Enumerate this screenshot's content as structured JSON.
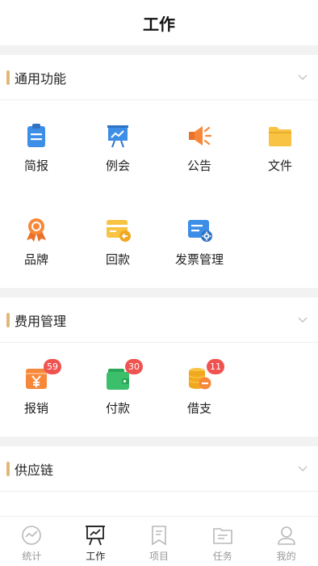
{
  "header": {
    "title": "工作"
  },
  "sections": [
    {
      "title": "通用功能",
      "items": [
        {
          "label": "简报",
          "icon": "clipboard-icon"
        },
        {
          "label": "例会",
          "icon": "presentation-board-icon"
        },
        {
          "label": "公告",
          "icon": "megaphone-icon"
        },
        {
          "label": "文件",
          "icon": "folder-icon"
        },
        {
          "label": "品牌",
          "icon": "award-ribbon-icon"
        },
        {
          "label": "回款",
          "icon": "card-return-icon"
        },
        {
          "label": "发票管理",
          "icon": "invoice-settings-icon"
        }
      ]
    },
    {
      "title": "费用管理",
      "items": [
        {
          "label": "报销",
          "icon": "yuan-tray-icon",
          "badge": "59"
        },
        {
          "label": "付款",
          "icon": "wallet-icon",
          "badge": "30"
        },
        {
          "label": "借支",
          "icon": "coin-stack-icon",
          "badge": "11"
        }
      ]
    },
    {
      "title": "供应链",
      "items": []
    }
  ],
  "tabbar": [
    {
      "label": "统计",
      "icon": "pulse-circle-icon",
      "active": false
    },
    {
      "label": "工作",
      "icon": "presentation-board-icon",
      "active": true
    },
    {
      "label": "项目",
      "icon": "bookmark-list-icon",
      "active": false
    },
    {
      "label": "任务",
      "icon": "task-folder-icon",
      "active": false
    },
    {
      "label": "我的",
      "icon": "user-icon",
      "active": false
    }
  ],
  "colors": {
    "section_accent": "#e3b777",
    "badge": "#ef5350",
    "icon_blue": "#3d8ee6",
    "icon_orange": "#f7883a",
    "icon_yellow": "#f8c342",
    "icon_green": "#3cbf6b",
    "tab_inactive": "#b8b8b8",
    "tab_active": "#222222"
  }
}
